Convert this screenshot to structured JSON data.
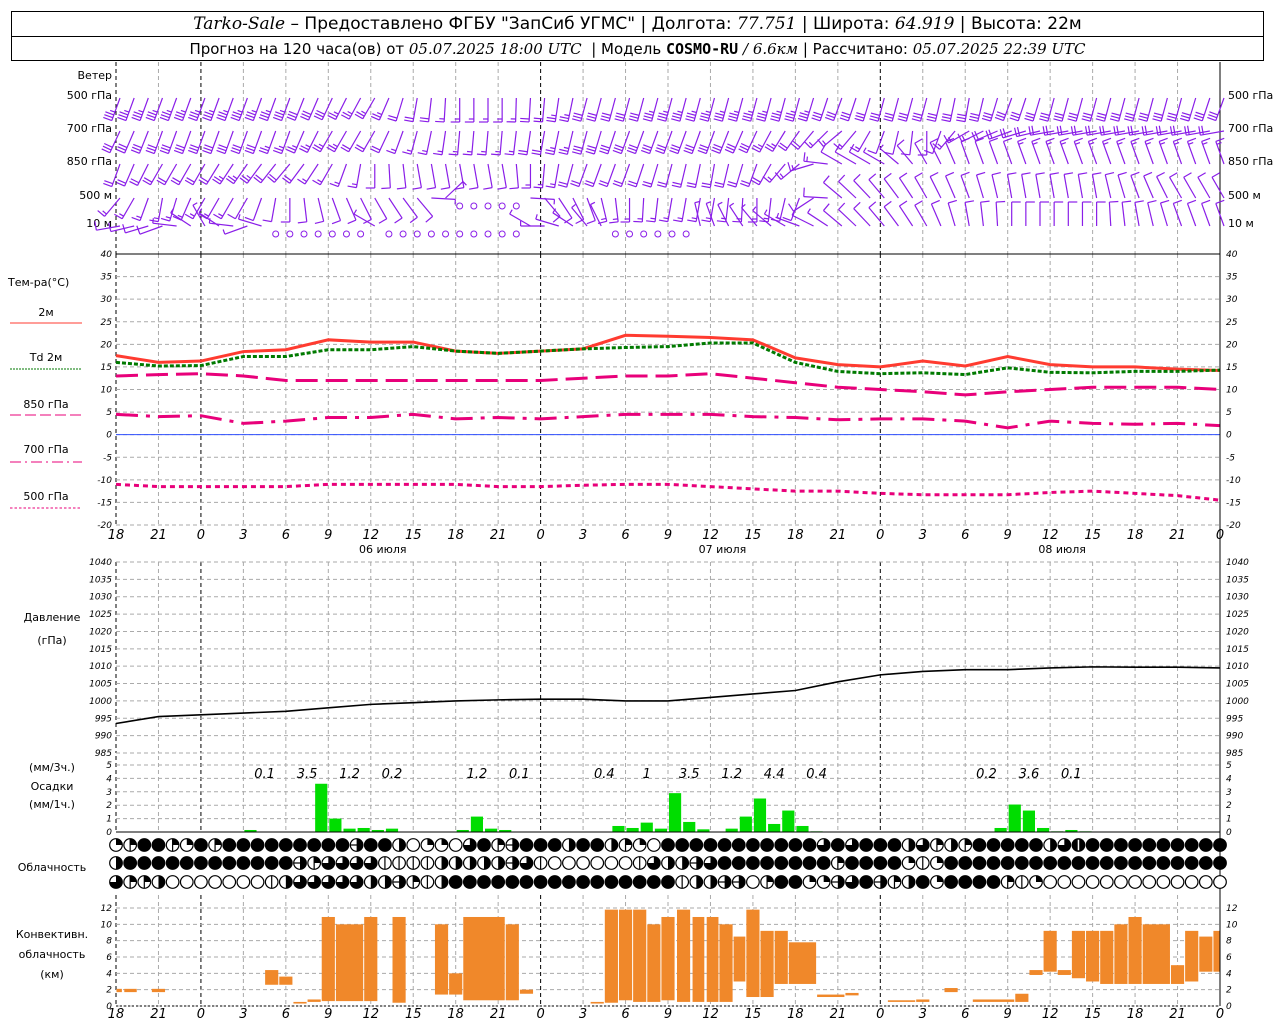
{
  "header": {
    "station": "Tarko-Sale",
    "provider": "– Предоставлено ФГБУ \"ЗапСиб УГМС\"",
    "lon_label": "Долгота:",
    "lon": "77.751",
    "lat_label": "Широта:",
    "lat": "64.919",
    "alt_label": "Высота:",
    "alt": "22м",
    "forecast_label": "Прогноз на 120 часа(ов) от",
    "forecast_start": "05.07.2025 18:00 UTC",
    "model_label": "Модель",
    "model": "COSMO-RU",
    "resolution": "/ 6.6км",
    "calc_label": "Рассчитано:",
    "calc_time": "05.07.2025 22:39 UTC"
  },
  "colors": {
    "t2m": "#ff3b30",
    "td2m": "#007a00",
    "t850": "#e8007a",
    "t700": "#e8007a",
    "t500": "#e8007a",
    "zero_line": "#3050ff",
    "pressure": "#000000",
    "precip": "#00dd00",
    "convective": "#f0882a",
    "wind": "#8a1ee8"
  },
  "time_axis": {
    "hours_total": 78,
    "tick_labels": [
      "18",
      "21",
      "0",
      "3",
      "6",
      "9",
      "12",
      "15",
      "18",
      "21",
      "0",
      "3",
      "6",
      "9",
      "12",
      "15",
      "18",
      "21",
      "0",
      "3",
      "6",
      "9",
      "12",
      "15",
      "18",
      "21",
      "0"
    ],
    "days": [
      {
        "label": "06 июля",
        "hour": 18
      },
      {
        "label": "07 июля",
        "hour": 42
      },
      {
        "label": "08 июля",
        "hour": 66
      }
    ],
    "midnight_hours": [
      6,
      30,
      54,
      78
    ]
  },
  "wind": {
    "title": "Ветер",
    "levels": [
      {
        "label_num": "500",
        "label_unit": "гПа",
        "dir": [
          200,
          200,
          200,
          200,
          200,
          205,
          210,
          190,
          180,
          180,
          185,
          195,
          195,
          195,
          195,
          195,
          195,
          200,
          195,
          195,
          190,
          200,
          195,
          195,
          195,
          195,
          200
        ],
        "speed": [
          17,
          17,
          17,
          17,
          17,
          14,
          12,
          10,
          8,
          8,
          10,
          15,
          15,
          17,
          17,
          17,
          17,
          15,
          15,
          15,
          15,
          15,
          15,
          15,
          15,
          15,
          15
        ]
      },
      {
        "label_num": "700",
        "label_unit": "гПа",
        "dir": [
          205,
          200,
          200,
          200,
          200,
          210,
          210,
          195,
          185,
          185,
          190,
          195,
          200,
          200,
          200,
          205,
          215,
          230,
          200,
          180,
          240,
          250,
          260,
          260,
          260,
          260,
          260
        ],
        "speed": [
          15,
          15,
          15,
          15,
          12,
          12,
          10,
          8,
          8,
          8,
          10,
          15,
          15,
          15,
          15,
          15,
          10,
          8,
          6,
          5,
          8,
          10,
          10,
          10,
          10,
          10,
          10
        ]
      },
      {
        "label_num": "850",
        "label_unit": "гПа",
        "dir": [
          200,
          210,
          210,
          215,
          220,
          210,
          180,
          170,
          170,
          170,
          185,
          200,
          200,
          195,
          190,
          200,
          230,
          300,
          300,
          330,
          340,
          340,
          340,
          340,
          340,
          340,
          340
        ],
        "speed": [
          10,
          10,
          10,
          12,
          10,
          8,
          6,
          5,
          5,
          5,
          8,
          10,
          10,
          10,
          10,
          10,
          8,
          6,
          3,
          5,
          6,
          6,
          7,
          7,
          7,
          7,
          7
        ]
      },
      {
        "label_num": "500",
        "label_unit": "м",
        "dir": [
          220,
          190,
          210,
          210,
          180,
          160,
          150,
          140,
          0,
          0,
          140,
          160,
          180,
          190,
          190,
          180,
          200,
          310,
          320,
          330,
          340,
          350,
          350,
          350,
          340,
          330,
          330
        ],
        "speed": [
          8,
          8,
          8,
          6,
          6,
          5,
          5,
          5,
          0,
          0,
          4,
          6,
          7,
          8,
          8,
          7,
          6,
          5,
          5,
          5,
          5,
          5,
          5,
          5,
          5,
          5,
          5
        ]
      },
      {
        "label_num": "10",
        "label_unit": "м",
        "dir": [
          260,
          250,
          330,
          250,
          0,
          0,
          300,
          0,
          0,
          0,
          270,
          320,
          0,
          0,
          340,
          320,
          290,
          310,
          320,
          330,
          350,
          360,
          360,
          360,
          350,
          340,
          340
        ],
        "speed": [
          4,
          4,
          3,
          3,
          0,
          0,
          2,
          0,
          0,
          0,
          3,
          3,
          0,
          0,
          3,
          3,
          3,
          4,
          4,
          4,
          4,
          4,
          4,
          4,
          4,
          4,
          4
        ]
      }
    ]
  },
  "chart_data": [
    {
      "type": "line",
      "ylabel": "Тем-ра(°С)",
      "ylim": [
        -20,
        40
      ],
      "yticks": [
        -20,
        -15,
        -10,
        -5,
        0,
        5,
        10,
        15,
        20,
        25,
        30,
        35,
        40
      ],
      "x_step_hours": 3,
      "grid": true,
      "legend_placement": "left",
      "series": [
        {
          "name": "2м",
          "values": [
            17.5,
            16,
            16.3,
            18.4,
            18.8,
            21,
            20.5,
            20.5,
            18.5,
            18,
            18.5,
            19,
            22,
            21.8,
            21.5,
            21,
            17,
            15.5,
            15,
            16.3,
            15.2,
            17.3,
            15.5,
            15,
            15,
            14.5,
            14.2
          ]
        },
        {
          "name": "Td 2м",
          "values": [
            16,
            15.2,
            15.3,
            17.3,
            17.3,
            18.8,
            18.8,
            19.5,
            18.5,
            18,
            18.5,
            19,
            19.3,
            19.5,
            20.3,
            20.3,
            16,
            14,
            13.5,
            13.7,
            13.3,
            14.8,
            13.8,
            13.7,
            14,
            14,
            14.3
          ]
        },
        {
          "name": "850 гПа",
          "values": [
            13,
            13.3,
            13.5,
            13,
            12,
            12,
            12,
            12,
            12,
            12,
            12,
            12.5,
            13,
            13,
            13.5,
            12.5,
            11.5,
            10.5,
            10,
            9.5,
            8.8,
            9.5,
            10,
            10.5,
            10.5,
            10.5,
            10
          ]
        },
        {
          "name": "700 гПа",
          "values": [
            4.5,
            4,
            4.2,
            2.5,
            3,
            3.8,
            3.8,
            4.5,
            3.5,
            3.8,
            3.5,
            4,
            4.5,
            4.5,
            4.5,
            4,
            3.8,
            3.3,
            3.5,
            3.5,
            3,
            1.5,
            3,
            2.5,
            2.3,
            2.5,
            2
          ]
        },
        {
          "name": "500 гПа",
          "values": [
            -11,
            -11.5,
            -11.5,
            -11.5,
            -11.5,
            -11,
            -11,
            -11,
            -11,
            -11.5,
            -11.5,
            -11.2,
            -11,
            -11,
            -11.5,
            -12,
            -12.5,
            -12.5,
            -13,
            -13.3,
            -13.3,
            -13.3,
            -12.8,
            -12.5,
            -13,
            -13.5,
            -14.5
          ]
        }
      ]
    },
    {
      "type": "line",
      "ylabel": "Давление",
      "yunit": "(гПа)",
      "ylim": [
        985,
        1040
      ],
      "yticks": [
        985,
        990,
        995,
        1000,
        1005,
        1010,
        1015,
        1020,
        1025,
        1030,
        1035,
        1040
      ],
      "x_step_hours": 3,
      "grid": true,
      "values": [
        993.5,
        995.5,
        996,
        996.5,
        997,
        998,
        999,
        999.5,
        1000,
        1000.3,
        1000.5,
        1000.5,
        1000,
        1000,
        1001,
        1002,
        1003,
        1005.5,
        1007.5,
        1008.5,
        1009,
        1009,
        1009.5,
        1009.8,
        1009.7,
        1009.7,
        1009.5
      ]
    },
    {
      "type": "bar",
      "ylabel": "Осадки",
      "ylabel_top": "(мм/3ч.)",
      "ylabel_bottom": "(мм/1ч.)",
      "ylim": [
        0,
        5
      ],
      "yticks": [
        0,
        1,
        2,
        3,
        4,
        5
      ],
      "hourly": [
        [
          9,
          0.15
        ],
        [
          14,
          3.6
        ],
        [
          15,
          1.0
        ],
        [
          16,
          0.25
        ],
        [
          17,
          0.3
        ],
        [
          18,
          0.15
        ],
        [
          19,
          0.25
        ],
        [
          24,
          0.15
        ],
        [
          25,
          1.15
        ],
        [
          26,
          0.25
        ],
        [
          27,
          0.15
        ],
        [
          35,
          0.45
        ],
        [
          36,
          0.3
        ],
        [
          37,
          0.7
        ],
        [
          38,
          0.25
        ],
        [
          39,
          2.9
        ],
        [
          40,
          0.75
        ],
        [
          41,
          0.2
        ],
        [
          43,
          0.25
        ],
        [
          44,
          1.15
        ],
        [
          45,
          2.5
        ],
        [
          46,
          0.6
        ],
        [
          47,
          1.6
        ],
        [
          48,
          0.45
        ],
        [
          49,
          0.05
        ],
        [
          62,
          0.3
        ],
        [
          63,
          2.05
        ],
        [
          64,
          1.6
        ],
        [
          65,
          0.3
        ],
        [
          66,
          0.05
        ],
        [
          67,
          0.15
        ],
        [
          68,
          0.05
        ]
      ],
      "sums_3h": [
        {
          "from": 9,
          "label": "0.1"
        },
        {
          "from": 12,
          "label": "3.5"
        },
        {
          "from": 15,
          "label": "1.2"
        },
        {
          "from": 18,
          "label": "0.2"
        },
        {
          "from": 24,
          "label": "1.2"
        },
        {
          "from": 27,
          "label": "0.1"
        },
        {
          "from": 33,
          "label": "0.4"
        },
        {
          "from": 36,
          "label": "1"
        },
        {
          "from": 39,
          "label": "3.5"
        },
        {
          "from": 42,
          "label": "1.2"
        },
        {
          "from": 45,
          "label": "4.4"
        },
        {
          "from": 48,
          "label": "0.4"
        },
        {
          "from": 60,
          "label": "0.2"
        },
        {
          "from": 63,
          "label": "3.6"
        },
        {
          "from": 66,
          "label": "0.1"
        }
      ]
    },
    {
      "type": "table",
      "ylabel": "Облачность",
      "encoding": "octas per hour, hours 0-78",
      "rows": [
        "2388328388888888858840220683588848843208888888888868688846343888884678888888888",
        "4888888888888536666111144444561000000164456888888883888821288888888888888888888",
        "6334000000014666664453148888888888888888144550388225685348288883120000000000000000"
      ]
    },
    {
      "type": "bar",
      "ylabel": "Конвективн.",
      "ylabel2": "облачность",
      "yunit": "(км)",
      "ylim": [
        0,
        13
      ],
      "yticks": [
        0,
        2,
        4,
        6,
        8,
        10,
        12
      ],
      "segments": [
        [
          0,
          0.45,
          1.7,
          2.1
        ],
        [
          0.55,
          1.5,
          1.7,
          2.1
        ],
        [
          2.5,
          3.5,
          1.7,
          2.1
        ],
        [
          10.5,
          11.5,
          2.6,
          4.4
        ],
        [
          11.5,
          12.5,
          2.6,
          3.6
        ],
        [
          12.5,
          13.5,
          0.3,
          0.5
        ],
        [
          13.5,
          14.5,
          0.5,
          0.8
        ],
        [
          14.5,
          15.5,
          0.6,
          10.9
        ],
        [
          15.5,
          17.5,
          0.6,
          10
        ],
        [
          17.5,
          18.5,
          0.6,
          10.9
        ],
        [
          19.5,
          20.5,
          0.4,
          10.9
        ],
        [
          22.5,
          23.5,
          1.4,
          10
        ],
        [
          23.5,
          24.5,
          1.4,
          4
        ],
        [
          24.5,
          27.5,
          0.7,
          10.9
        ],
        [
          27.5,
          28.5,
          0.7,
          10
        ],
        [
          28.5,
          29.5,
          1.5,
          2
        ],
        [
          33.5,
          34.5,
          0.3,
          0.5
        ],
        [
          34.5,
          35.5,
          0.4,
          11.8
        ],
        [
          35.5,
          36.5,
          0.7,
          11.8
        ],
        [
          36.5,
          37.5,
          0.5,
          11.8
        ],
        [
          37.5,
          38.5,
          0.5,
          10
        ],
        [
          38.5,
          39.5,
          0.7,
          10.9
        ],
        [
          39.6,
          40.6,
          0.5,
          11.8
        ],
        [
          40.7,
          41.6,
          0.5,
          10.9
        ],
        [
          41.7,
          42.6,
          0.5,
          10.9
        ],
        [
          42.6,
          43.6,
          0.5,
          10
        ],
        [
          43.6,
          44.5,
          3,
          8.5
        ],
        [
          44.5,
          45.5,
          1.1,
          11.8
        ],
        [
          45.5,
          46.5,
          1.1,
          9.2
        ],
        [
          46.5,
          47.5,
          2.7,
          9.2
        ],
        [
          47.5,
          49.5,
          2.7,
          7.8
        ],
        [
          49.5,
          51.5,
          1.1,
          1.4
        ],
        [
          51.5,
          52.5,
          1.3,
          1.6
        ],
        [
          54.5,
          56.5,
          0.5,
          0.7
        ],
        [
          56.5,
          57.5,
          0.5,
          0.8
        ],
        [
          58.5,
          59.5,
          1.7,
          2.2
        ],
        [
          60.5,
          63.5,
          0.5,
          0.8
        ],
        [
          63.5,
          64.5,
          0.5,
          1.5
        ],
        [
          64.5,
          65.5,
          3.8,
          4.4
        ],
        [
          65.5,
          66.5,
          4.2,
          9.2
        ],
        [
          66.5,
          67.5,
          3.8,
          4.4
        ],
        [
          67.5,
          68.5,
          3.4,
          9.2
        ],
        [
          68.5,
          69.5,
          3,
          9.2
        ],
        [
          69.5,
          70.5,
          2.7,
          9.2
        ],
        [
          70.5,
          71.5,
          2.7,
          10
        ],
        [
          71.5,
          72.5,
          2.7,
          10.9
        ],
        [
          72.5,
          74.5,
          2.7,
          10
        ],
        [
          74.5,
          75.5,
          2.7,
          5
        ],
        [
          75.5,
          76.5,
          3,
          9.2
        ],
        [
          76.5,
          77.5,
          4.2,
          8.5
        ],
        [
          77.5,
          78,
          4.2,
          9.2
        ]
      ]
    }
  ]
}
